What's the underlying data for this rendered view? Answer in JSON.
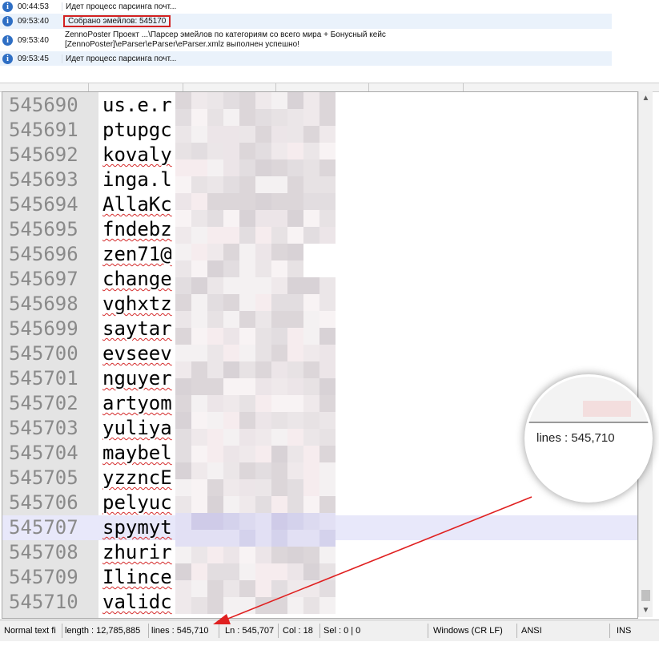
{
  "log": [
    {
      "time": "00:44:53",
      "message": "Идет процесс парсинга почт...",
      "highlight": false
    },
    {
      "time": "09:53:40",
      "message": "Собрано эмейлов: 545170",
      "highlight": true
    },
    {
      "time": "09:53:40",
      "message_line1": "ZennoPoster Проект ...\\Парсер эмейлов по категориям со всего мира + Бонусный кейс",
      "message_line2": "[ZennoPoster]\\eParser\\eParser\\eParser.xmlz выполнен успешно!",
      "highlight": false
    },
    {
      "time": "09:53:45",
      "message": "Идет процесс парсинга почт...",
      "highlight": false
    }
  ],
  "editor": {
    "current_line": "545707",
    "lines": [
      {
        "num": "545690",
        "text": "us.e.r",
        "tail": "r@100ss.ru"
      },
      {
        "num": "545691",
        "text": "ptupgc",
        "tail": ".press"
      },
      {
        "num": "545692",
        "text": "kovaly",
        "tail": "ail.ru"
      },
      {
        "num": "545693",
        "text": "inga.l",
        "tail": "il.ru"
      },
      {
        "num": "545694",
        "text": "AllaKc",
        "tail": ".ru"
      },
      {
        "num": "545695",
        "text": "fndebz",
        "tail": "u"
      },
      {
        "num": "545696",
        "text": "zen71@",
        "tail": ""
      },
      {
        "num": "545697",
        "text": "change",
        "tail": "yandex.ru"
      },
      {
        "num": "545698",
        "text": "vghxtz",
        "tail": "ress"
      },
      {
        "num": "545699",
        "text": "saytar",
        "tail": ".ru"
      },
      {
        "num": "545700",
        "text": "evseev",
        "tail": "l.ru"
      },
      {
        "num": "545701",
        "text": "nguyer",
        "tail": "990@gmail.com"
      },
      {
        "num": "545702",
        "text": "artyom",
        "tail": "@mail.ru"
      },
      {
        "num": "545703",
        "text": "yuliya",
        "tail": "l.ru"
      },
      {
        "num": "545704",
        "text": "maybel",
        "tail": "iti.com"
      },
      {
        "num": "545705",
        "text": "yzzncE",
        "tail": "@greenbets.co"
      },
      {
        "num": "545706",
        "text": "pelyuc",
        "tail": "l.ru"
      },
      {
        "num": "545707",
        "text": "spymyt",
        "tail": ""
      },
      {
        "num": "545708",
        "text": "zhurir",
        "tail": ".ru"
      },
      {
        "num": "545709",
        "text": "Ilince",
        "tail": "mail.ru"
      },
      {
        "num": "545710",
        "text": "validc",
        "tail": ""
      }
    ]
  },
  "status": {
    "type": "Normal text fi",
    "length": "length : 12,785,885",
    "lines": "lines : 545,710",
    "ln": "Ln : 545,707",
    "col": "Col : 18",
    "sel": "Sel : 0 | 0",
    "eol": "Windows (CR LF)",
    "encoding": "ANSI",
    "mode": "INS"
  },
  "magnifier": {
    "label": "lines : 545,710"
  },
  "colors": {
    "highlight_box": "#d32121",
    "arrow": "#e02020",
    "current_line": "#e8e8fa",
    "gutter": "#e4e4e4"
  }
}
